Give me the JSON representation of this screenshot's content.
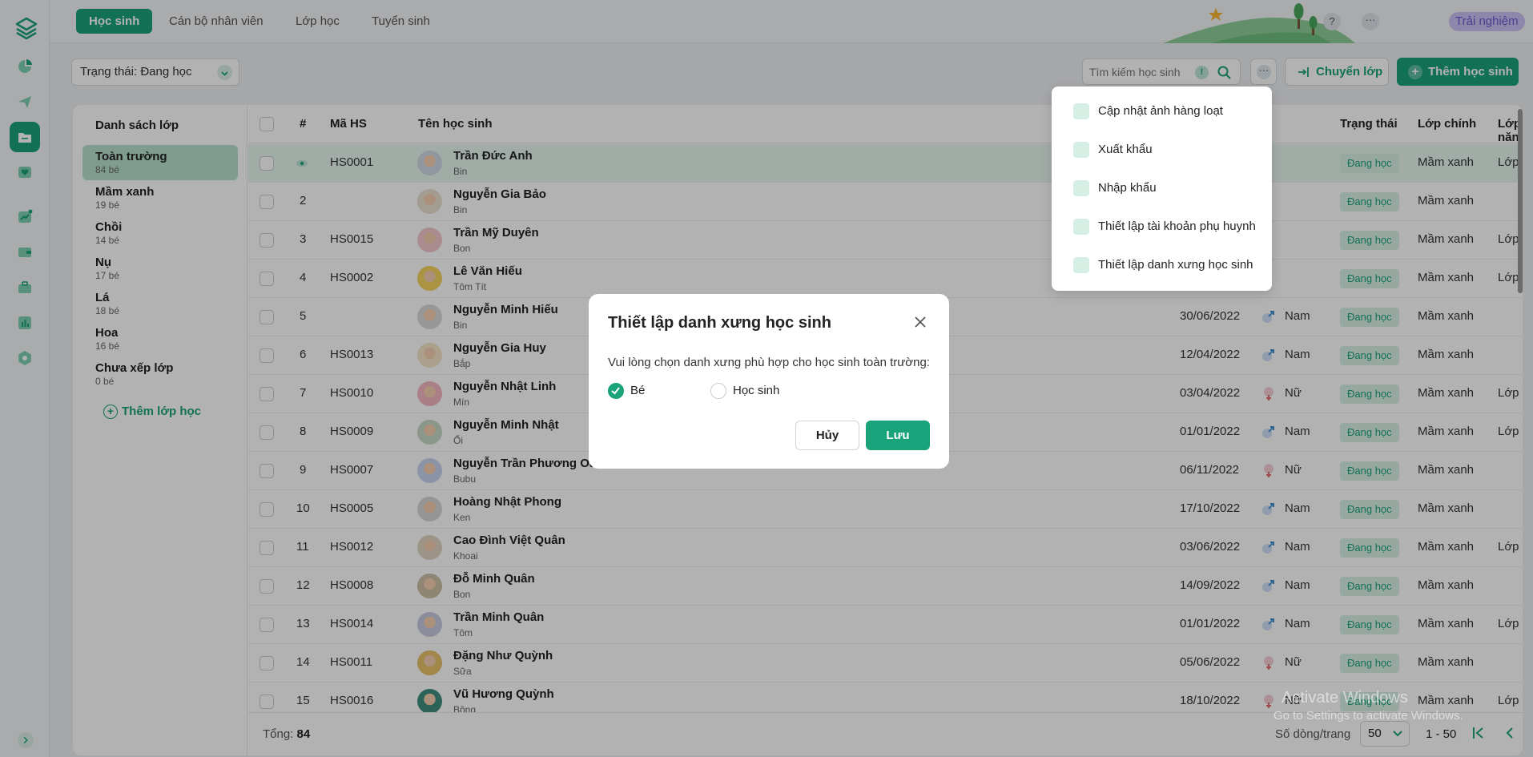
{
  "topnav": {
    "tabs": [
      "Học sinh",
      "Cán bộ nhân viên",
      "Lớp học",
      "Tuyển sinh"
    ],
    "help": "?",
    "more": "···",
    "trial": "Trải nghiệm"
  },
  "filter": {
    "status": "Trạng thái: Đang học",
    "search_placeholder": "Tìm kiếm học sinh",
    "info": "!",
    "more": "···",
    "move_label": "Chuyển lớp",
    "add_label": "Thêm học sinh"
  },
  "classes": {
    "title": "Danh sách lớp",
    "items": [
      {
        "name": "Toàn trường",
        "count": "84 bé"
      },
      {
        "name": "Mầm xanh",
        "count": "19 bé"
      },
      {
        "name": "Chồi",
        "count": "14 bé"
      },
      {
        "name": "Nụ",
        "count": "17 bé"
      },
      {
        "name": "Lá",
        "count": "18 bé"
      },
      {
        "name": "Hoa",
        "count": "16 bé"
      },
      {
        "name": "Chưa xếp lớp",
        "count": "0 bé"
      }
    ],
    "add_label": "Thêm lớp học"
  },
  "table": {
    "headers": {
      "index": "#",
      "code": "Mã HS",
      "name": "Tên học sinh",
      "status": "Trạng thái",
      "main_class": "Lớp chính",
      "talent_class": "Lớp năng khiếu"
    },
    "rows": [
      {
        "idx": "",
        "code": "HS0001",
        "name": "Trần Đức Anh",
        "nick": "Bin",
        "dob": "",
        "gender": "",
        "status": "Đang học",
        "cls": "Mầm xanh",
        "talent": "Lớp vẽ"
      },
      {
        "idx": "2",
        "code": "",
        "name": "Nguyễn Gia Bảo",
        "nick": "Bin",
        "dob": "",
        "gender": "",
        "status": "Đang học",
        "cls": "Mầm xanh",
        "talent": ""
      },
      {
        "idx": "3",
        "code": "HS0015",
        "name": "Trần Mỹ Duyên",
        "nick": "Bon",
        "dob": "",
        "gender": "",
        "status": "Đang học",
        "cls": "Mầm xanh",
        "talent": "Lớp vẽ"
      },
      {
        "idx": "4",
        "code": "HS0002",
        "name": "Lê Văn Hiếu",
        "nick": "Tôm Tít",
        "dob": "",
        "gender": "",
        "status": "Đang học",
        "cls": "Mầm xanh",
        "talent": "Lớp vẽ"
      },
      {
        "idx": "5",
        "code": "",
        "name": "Nguyễn Minh Hiếu",
        "nick": "Bin",
        "dob": "30/06/2022",
        "gender": "Nam",
        "status": "Đang học",
        "cls": "Mầm xanh",
        "talent": ""
      },
      {
        "idx": "6",
        "code": "HS0013",
        "name": "Nguyễn Gia Huy",
        "nick": "Bắp",
        "dob": "12/04/2022",
        "gender": "Nam",
        "status": "Đang học",
        "cls": "Mầm xanh",
        "talent": ""
      },
      {
        "idx": "7",
        "code": "HS0010",
        "name": "Nguyễn Nhật Linh",
        "nick": "Mín",
        "dob": "03/04/2022",
        "gender": "Nữ",
        "status": "Đang học",
        "cls": "Mầm xanh",
        "talent": "Lớp vẽ"
      },
      {
        "idx": "8",
        "code": "HS0009",
        "name": "Nguyễn Minh Nhật",
        "nick": "Ổi",
        "dob": "01/01/2022",
        "gender": "Nam",
        "status": "Đang học",
        "cls": "Mầm xanh",
        "talent": "Lớp vẽ"
      },
      {
        "idx": "9",
        "code": "HS0007",
        "name": "Nguyễn Trần Phương Oan",
        "nick": "Bubu",
        "dob": "06/11/2022",
        "gender": "Nữ",
        "status": "Đang học",
        "cls": "Mầm xanh",
        "talent": ""
      },
      {
        "idx": "10",
        "code": "HS0005",
        "name": "Hoàng Nhật Phong",
        "nick": "Ken",
        "dob": "17/10/2022",
        "gender": "Nam",
        "status": "Đang học",
        "cls": "Mầm xanh",
        "talent": ""
      },
      {
        "idx": "11",
        "code": "HS0012",
        "name": "Cao Đình Việt Quân",
        "nick": "Khoai",
        "dob": "03/06/2022",
        "gender": "Nam",
        "status": "Đang học",
        "cls": "Mầm xanh",
        "talent": "Lớp vẽ"
      },
      {
        "idx": "12",
        "code": "HS0008",
        "name": "Đỗ Minh Quân",
        "nick": "Bon",
        "dob": "14/09/2022",
        "gender": "Nam",
        "status": "Đang học",
        "cls": "Mầm xanh",
        "talent": ""
      },
      {
        "idx": "13",
        "code": "HS0014",
        "name": "Trần Minh Quân",
        "nick": "Tôm",
        "dob": "01/01/2022",
        "gender": "Nam",
        "status": "Đang học",
        "cls": "Mầm xanh",
        "talent": "Lớp vẽ"
      },
      {
        "idx": "14",
        "code": "HS0011",
        "name": "Đặng Như Quỳnh",
        "nick": "Sữa",
        "dob": "05/06/2022",
        "gender": "Nữ",
        "status": "Đang học",
        "cls": "Mầm xanh",
        "talent": ""
      },
      {
        "idx": "15",
        "code": "HS0016",
        "name": "Vũ Hương Quỳnh",
        "nick": "Bông",
        "dob": "18/10/2022",
        "gender": "Nữ",
        "status": "Đang học",
        "cls": "Mầm xanh",
        "talent": "Lớp vẽ"
      }
    ]
  },
  "footer": {
    "total_label": "Tổng:",
    "total_value": "84",
    "rows_per_page_label": "Số dòng/trang",
    "rows_per_page": "50",
    "range": "1 - 50"
  },
  "menu": {
    "items": [
      "Cập nhật ảnh hàng loạt",
      "Xuất khẩu",
      "Nhập khẩu",
      "Thiết lập tài khoản phụ huynh",
      "Thiết lập danh xưng học sinh"
    ]
  },
  "modal": {
    "title": "Thiết lập danh xưng học sinh",
    "description": "Vui lòng chọn danh xưng phù hợp cho học sinh toàn trường:",
    "option_1": "Bé",
    "option_2": "Học sinh",
    "selected": "Bé",
    "cancel": "Hủy",
    "save": "Lưu"
  },
  "watermark": {
    "line1": "Activate Windows",
    "line2": "Go to Settings to activate Windows."
  },
  "colors": {
    "primary": "#1aa37a",
    "trial_bg": "#c9c2f5",
    "male": "#4a90d9",
    "female": "#e06b7a"
  }
}
